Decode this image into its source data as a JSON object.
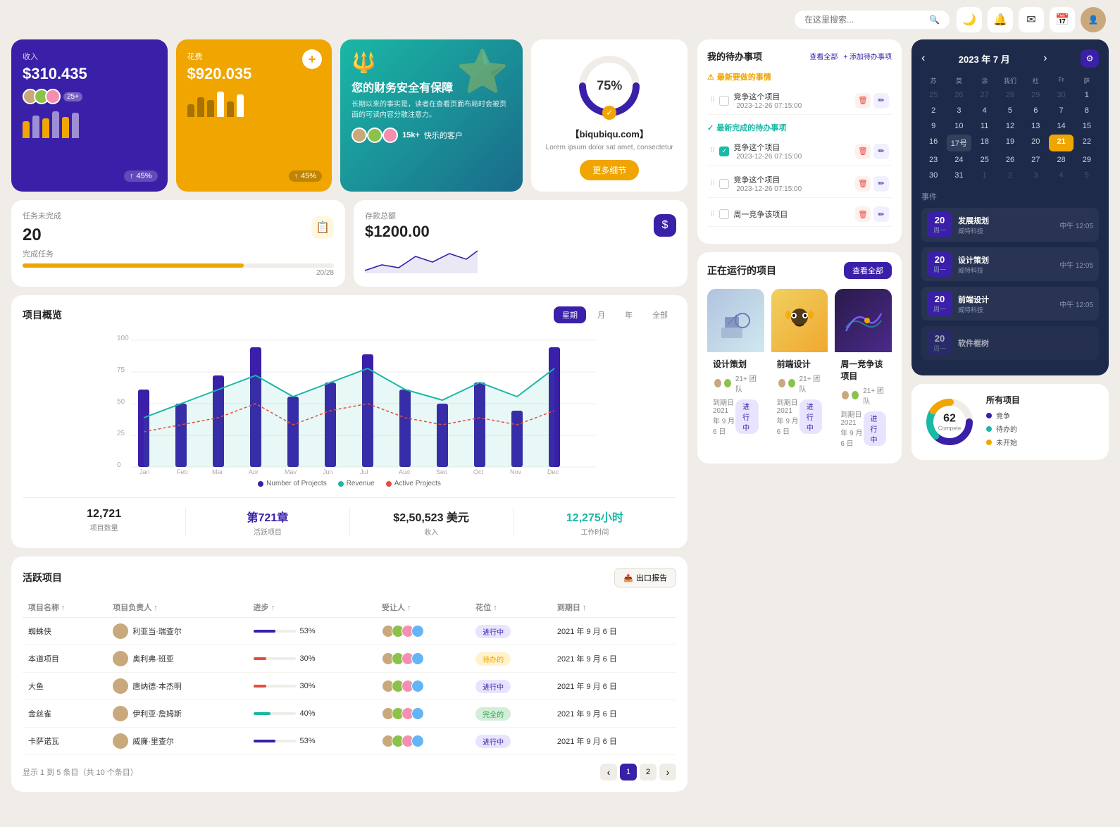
{
  "topbar": {
    "search_placeholder": "在这里搜索...",
    "icons": [
      "🌙",
      "🔔",
      "✉",
      "📅"
    ]
  },
  "revenue_card": {
    "label": "收入",
    "amount": "$310.435",
    "plus_count": "25+",
    "percent": "45%",
    "bars": [
      30,
      50,
      40,
      60,
      45,
      55
    ]
  },
  "expense_card": {
    "label": "花费",
    "amount": "$920.035",
    "percent": "45%",
    "bars": [
      20,
      40,
      35,
      55,
      30,
      45
    ]
  },
  "promo_card": {
    "title": "您的财务安全有保障",
    "desc": "长期以来的事实是，读者在查看页面布局时会被页面的可读内容分散注意力。",
    "customers": "15k+",
    "customers_label": "快乐的客户"
  },
  "gauge_card": {
    "percent": "75%",
    "site_name": "【biqubiqu.com】",
    "desc": "Lorem ipsum dolor sat amet, consectetur",
    "btn_label": "更多细节"
  },
  "tasks_card": {
    "label": "任务未完成",
    "count": "20",
    "label2": "完成任务",
    "progress": 71,
    "done": "20/28"
  },
  "savings_card": {
    "label": "存款总额",
    "amount": "$1200.00"
  },
  "project_overview": {
    "title": "项目概览",
    "tabs": [
      "星期",
      "月",
      "年",
      "全部"
    ],
    "active_tab": 0,
    "y_labels": [
      "100",
      "75",
      "50",
      "25",
      "0"
    ],
    "x_labels": [
      "Jan",
      "Feb",
      "Mar",
      "Apr",
      "May",
      "Jun",
      "Jul",
      "Aug",
      "Sep",
      "Oct",
      "Nov",
      "Dec"
    ],
    "legend": [
      {
        "label": "Number of Projects",
        "color": "#3a1fa8"
      },
      {
        "label": "Revenue",
        "color": "#1ab8a6"
      },
      {
        "label": "Active Projects",
        "color": "#e74c3c"
      }
    ],
    "stats": [
      {
        "value": "12,721",
        "label": "项目数量"
      },
      {
        "value": "第721章",
        "label": "活跃项目"
      },
      {
        "value": "$2,50,523 美元",
        "label": "收入"
      },
      {
        "value": "12,275小时",
        "label": "工作时间"
      }
    ]
  },
  "active_projects": {
    "title": "活跃项目",
    "export_label": "出口报告",
    "columns": [
      "项目名称",
      "项目负责人",
      "进步",
      "受让人",
      "花位",
      "到期日"
    ],
    "rows": [
      {
        "name": "蜘蛛侠",
        "manager": "利亚当·瑞查尔",
        "progress": 53,
        "progress_color": "#3a1fa8",
        "assignees": 4,
        "status": "进行中",
        "status_class": "status-inprogress",
        "due": "2021 年 9 月 6 日"
      },
      {
        "name": "本道项目",
        "manager": "奥利弗·班亚",
        "progress": 30,
        "progress_color": "#e74c3c",
        "assignees": 4,
        "status": "待办的",
        "status_class": "status-pending",
        "due": "2021 年 9 月 6 日"
      },
      {
        "name": "大鱼",
        "manager": "唐纳德·本杰明",
        "progress": 30,
        "progress_color": "#e74c3c",
        "assignees": 4,
        "status": "进行中",
        "status_class": "status-inprogress",
        "due": "2021 年 9 月 6 日"
      },
      {
        "name": "金丝雀",
        "manager": "伊利亚·詹姆斯",
        "progress": 40,
        "progress_color": "#1ab8a6",
        "assignees": 4,
        "status": "完全的",
        "status_class": "status-complete",
        "due": "2021 年 9 月 6 日"
      },
      {
        "name": "卡萨诺瓦",
        "manager": "威廉·里查尔",
        "progress": 53,
        "progress_color": "#3a1fa8",
        "assignees": 4,
        "status": "进行中",
        "status_class": "status-inprogress",
        "due": "2021 年 9 月 6 日"
      }
    ],
    "pagination_info": "显示 1 到 5 条目（共 10 个条目）",
    "current_page": 1,
    "total_pages": 2
  },
  "todo": {
    "title": "我的待办事项",
    "view_all": "查看全部",
    "add_label": "+ 添加待办事项",
    "urgent_label": "最新要做的事情",
    "urgent_color": "#f0a500",
    "recent_label": "最新完成的待办事项",
    "recent_color": "#1ab8a6",
    "items": [
      {
        "text": "竞争这个项目",
        "date": "2023-12-26 07:15:00",
        "done": false,
        "section": "urgent"
      },
      {
        "text": "竞争这个项目",
        "date": "2023-12-26 07:15:00",
        "done": true,
        "section": "recent"
      },
      {
        "text": "竞争这个项目",
        "date": "2023-12-26 07:15:00",
        "done": false,
        "section": "other"
      },
      {
        "text": "周一竞争该项目",
        "date": "",
        "done": false,
        "section": "other2"
      }
    ]
  },
  "running_projects": {
    "title": "正在运行的项目",
    "view_all": "查看全部",
    "projects": [
      {
        "name": "设计策划",
        "team": "21+ 团队",
        "due_label": "到期日",
        "due": "2021 年 9 月 6 日",
        "status": "进行中",
        "status_class": "status-inprogress",
        "img_class": "proj-img-1"
      },
      {
        "name": "前端设计",
        "team": "21+ 团队",
        "due_label": "到期日",
        "due": "2021 年 9 月 6 日",
        "status": "进行中",
        "status_class": "status-inprogress",
        "img_class": "proj-img-2"
      },
      {
        "name": "周一竞争该项目",
        "team": "21+ 团队",
        "due_label": "到期日",
        "due": "2021 年 9 月 6 日",
        "status": "进行中",
        "status_class": "status-inprogress",
        "img_class": "proj-img-3"
      }
    ]
  },
  "calendar": {
    "title": "2023 年 7 月",
    "day_headers": [
      "苏",
      "莫",
      "涂",
      "我们",
      "社",
      "Fr",
      "萨"
    ],
    "prev_month_days": [
      25,
      26,
      27,
      28,
      29,
      30,
      1
    ],
    "weeks": [
      [
        2,
        3,
        4,
        5,
        6,
        7,
        8
      ],
      [
        9,
        10,
        11,
        12,
        13,
        14,
        15
      ],
      [
        16,
        "17号",
        18,
        19,
        20,
        21,
        22
      ],
      [
        23,
        24,
        25,
        26,
        27,
        28,
        29
      ],
      [
        30,
        31,
        1,
        2,
        3,
        4,
        5
      ]
    ],
    "today": 21,
    "events_label": "事件",
    "events": [
      {
        "day": "20",
        "weekday": "周一",
        "name": "发展规划",
        "org": "威特科技",
        "time": "中午 12:05"
      },
      {
        "day": "20",
        "weekday": "周一",
        "name": "设计策划",
        "org": "威特科技",
        "time": "中午 12:05"
      },
      {
        "day": "20",
        "weekday": "周一",
        "name": "前端设计",
        "org": "威特科技",
        "time": "中午 12:05"
      },
      {
        "day": "20",
        "weekday": "周一",
        "name": "软件框树",
        "org": "...",
        "time": ""
      }
    ]
  },
  "donut": {
    "title": "所有项目",
    "center_num": "62",
    "center_label": "Compete",
    "segments": [
      {
        "label": "竞争",
        "color": "#3a1fa8",
        "value": 62
      },
      {
        "label": "待办的",
        "color": "#1ab8a6",
        "value": 22
      },
      {
        "label": "未开始",
        "color": "#f0a500",
        "value": 16
      }
    ]
  }
}
